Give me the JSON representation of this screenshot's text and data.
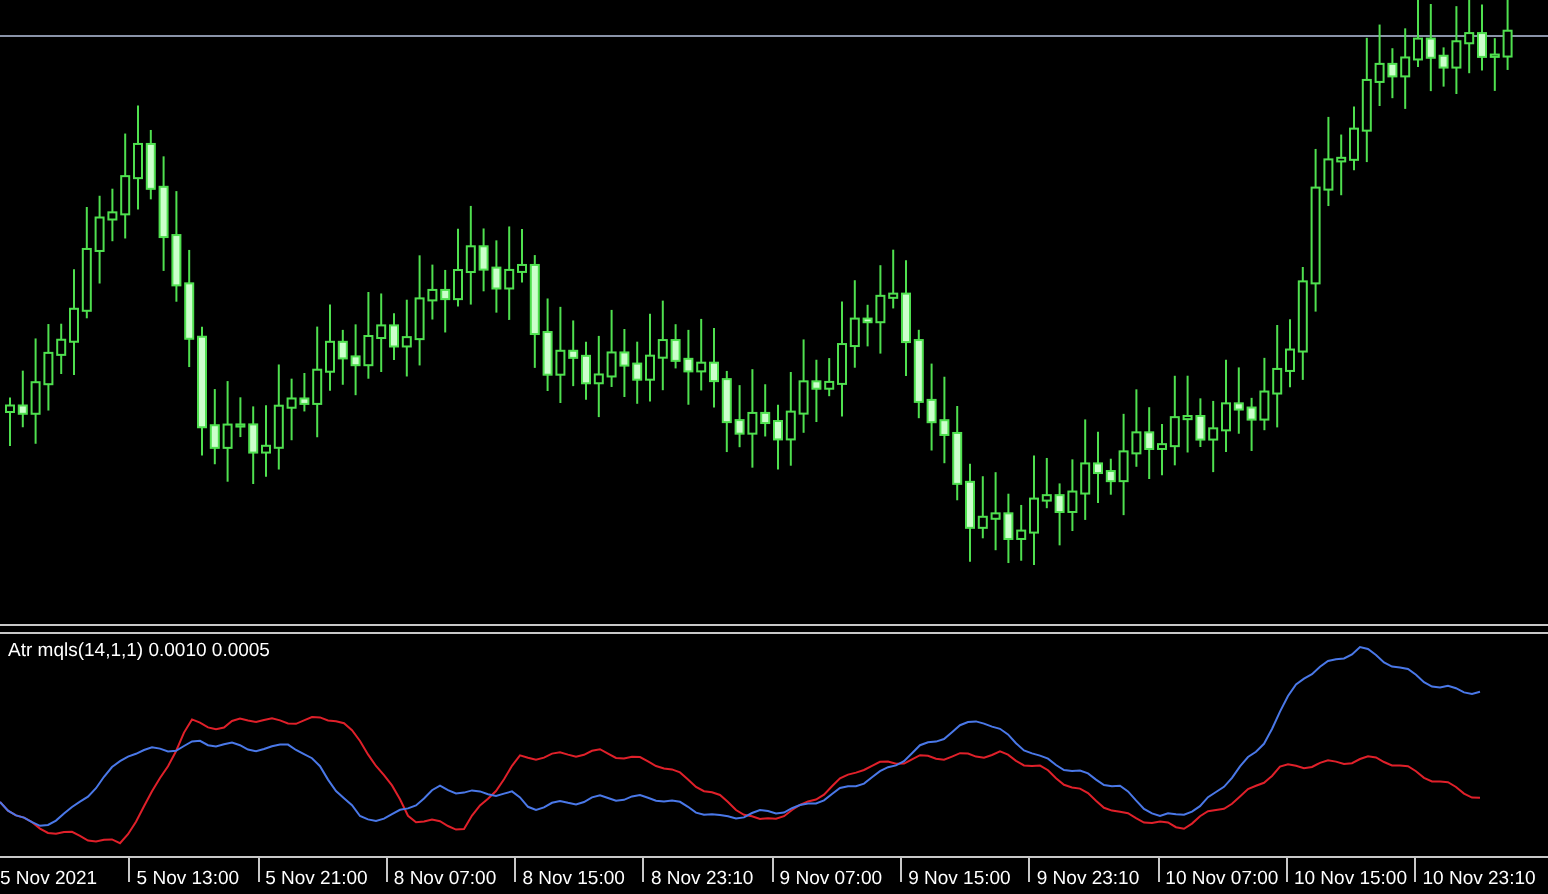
{
  "indicator": {
    "label": "Atr mqls(14,1,1) 0.0010 0.0005"
  },
  "time_axis": {
    "labels": [
      "5 Nov 2021",
      "5 Nov 13:00",
      "5 Nov 21:00",
      "8 Nov 07:00",
      "8 Nov 15:00",
      "8 Nov 23:10",
      "9 Nov 07:00",
      "9 Nov 15:00",
      "9 Nov 23:10",
      "10 Nov 07:00",
      "10 Nov 15:00",
      "10 Nov 23:10"
    ]
  }
}
